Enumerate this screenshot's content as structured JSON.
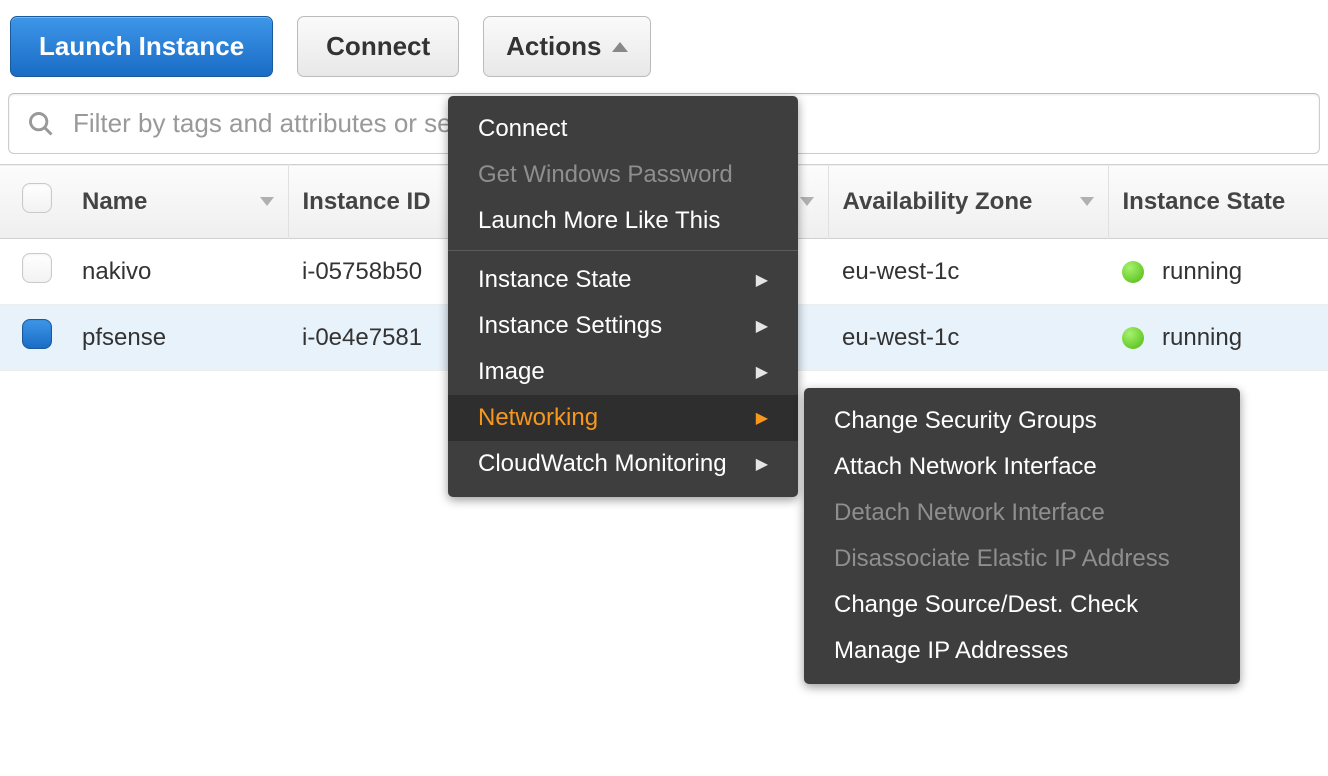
{
  "toolbar": {
    "launch": "Launch Instance",
    "connect": "Connect",
    "actions": "Actions"
  },
  "search": {
    "placeholder": "Filter by tags and attributes or search by keyword"
  },
  "columns": {
    "name": "Name",
    "instance_id": "Instance ID",
    "availability_zone": "Availability Zone",
    "instance_state": "Instance State"
  },
  "rows": [
    {
      "selected": false,
      "name": "nakivo",
      "instance_id": "i-05758b50",
      "az": "eu-west-1c",
      "state": "running",
      "state_color": "green"
    },
    {
      "selected": true,
      "name": "pfsense",
      "instance_id": "i-0e4e7581",
      "az": "eu-west-1c",
      "state": "running",
      "state_color": "green"
    }
  ],
  "actions_menu": {
    "items": [
      {
        "label": "Connect",
        "enabled": true,
        "submenu": false
      },
      {
        "label": "Get Windows Password",
        "enabled": false,
        "submenu": false
      },
      {
        "label": "Launch More Like This",
        "enabled": true,
        "submenu": false
      }
    ],
    "items2": [
      {
        "label": "Instance State",
        "enabled": true,
        "submenu": true,
        "active": false
      },
      {
        "label": "Instance Settings",
        "enabled": true,
        "submenu": true,
        "active": false
      },
      {
        "label": "Image",
        "enabled": true,
        "submenu": true,
        "active": false
      },
      {
        "label": "Networking",
        "enabled": true,
        "submenu": true,
        "active": true
      },
      {
        "label": "CloudWatch Monitoring",
        "enabled": true,
        "submenu": true,
        "active": false
      }
    ]
  },
  "networking_submenu": [
    {
      "label": "Change Security Groups",
      "enabled": true
    },
    {
      "label": "Attach Network Interface",
      "enabled": true
    },
    {
      "label": "Detach Network Interface",
      "enabled": false
    },
    {
      "label": "Disassociate Elastic IP Address",
      "enabled": false
    },
    {
      "label": "Change Source/Dest. Check",
      "enabled": true
    },
    {
      "label": "Manage IP Addresses",
      "enabled": true
    }
  ]
}
